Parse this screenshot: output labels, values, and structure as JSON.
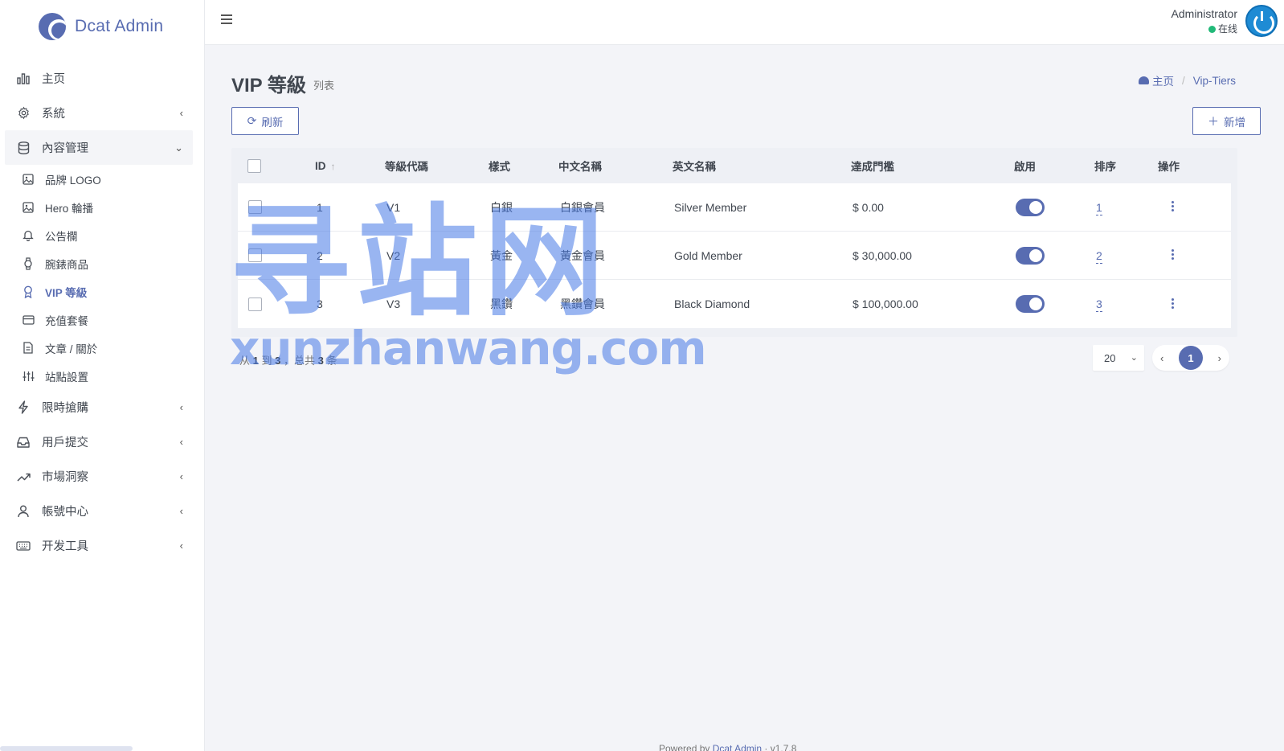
{
  "brand": {
    "name": "Dcat Admin"
  },
  "sidebar": {
    "items": [
      {
        "label": "主页",
        "icon": "bar-chart-icon"
      },
      {
        "label": "系統",
        "icon": "gear-icon"
      },
      {
        "label": "內容管理",
        "icon": "database-icon"
      },
      {
        "label": "限時搶購",
        "icon": "lightning-icon"
      },
      {
        "label": "用戶提交",
        "icon": "inbox-icon"
      },
      {
        "label": "市場洞察",
        "icon": "trend-icon"
      },
      {
        "label": "帳號中心",
        "icon": "user-icon"
      },
      {
        "label": "开发工具",
        "icon": "keyboard-icon"
      }
    ],
    "sub_items": [
      {
        "label": "品牌 LOGO",
        "icon": "image-icon"
      },
      {
        "label": "Hero 輪播",
        "icon": "image-icon"
      },
      {
        "label": "公告欄",
        "icon": "bell-icon"
      },
      {
        "label": "腕錶商品",
        "icon": "watch-icon"
      },
      {
        "label": "VIP 等級",
        "icon": "award-icon"
      },
      {
        "label": "充值套餐",
        "icon": "card-icon"
      },
      {
        "label": "文章 / 關於",
        "icon": "document-icon"
      },
      {
        "label": "站點設置",
        "icon": "sliders-icon"
      }
    ]
  },
  "header": {
    "user_name": "Administrator",
    "user_status": "在线"
  },
  "page": {
    "title": "VIP 等級",
    "subtitle": "列表",
    "breadcrumb": {
      "home": "主页",
      "current": "Vip-Tiers"
    },
    "refresh_label": "刷新",
    "add_label": "新增"
  },
  "table": {
    "columns": [
      "ID",
      "等級代碼",
      "樣式",
      "中文名稱",
      "英文名稱",
      "達成門檻",
      "啟用",
      "排序",
      "操作"
    ],
    "rows": [
      {
        "id": "1",
        "code": "V1",
        "style": "白銀",
        "name_zh": "白銀會員",
        "name_en": "Silver Member",
        "threshold": "$ 0.00",
        "enabled": true,
        "order": "1"
      },
      {
        "id": "2",
        "code": "V2",
        "style": "黃金",
        "name_zh": "黃金會員",
        "name_en": "Gold Member",
        "threshold": "$ 30,000.00",
        "enabled": true,
        "order": "2"
      },
      {
        "id": "3",
        "code": "V3",
        "style": "黑鑽",
        "name_zh": "黑鑽會員",
        "name_en": "Black Diamond",
        "threshold": "$ 100,000.00",
        "enabled": true,
        "order": "3"
      }
    ]
  },
  "pager": {
    "info_from": "从",
    "start": "1",
    "info_to": "到",
    "end": "3",
    "info_total": "，总共",
    "total": "3",
    "info_unit": "条",
    "per_page": "20",
    "current_page": "1",
    "prev": "‹",
    "next": "›"
  },
  "footer": {
    "prefix": "Powered by",
    "link": "Dcat Admin",
    "version": "· v1.7.8"
  },
  "watermark": {
    "big": "寻站网",
    "small": "xunzhanwang.com"
  },
  "colors": {
    "accent": "#586cb1",
    "online": "#21b978",
    "background": "#f3f4f8"
  }
}
